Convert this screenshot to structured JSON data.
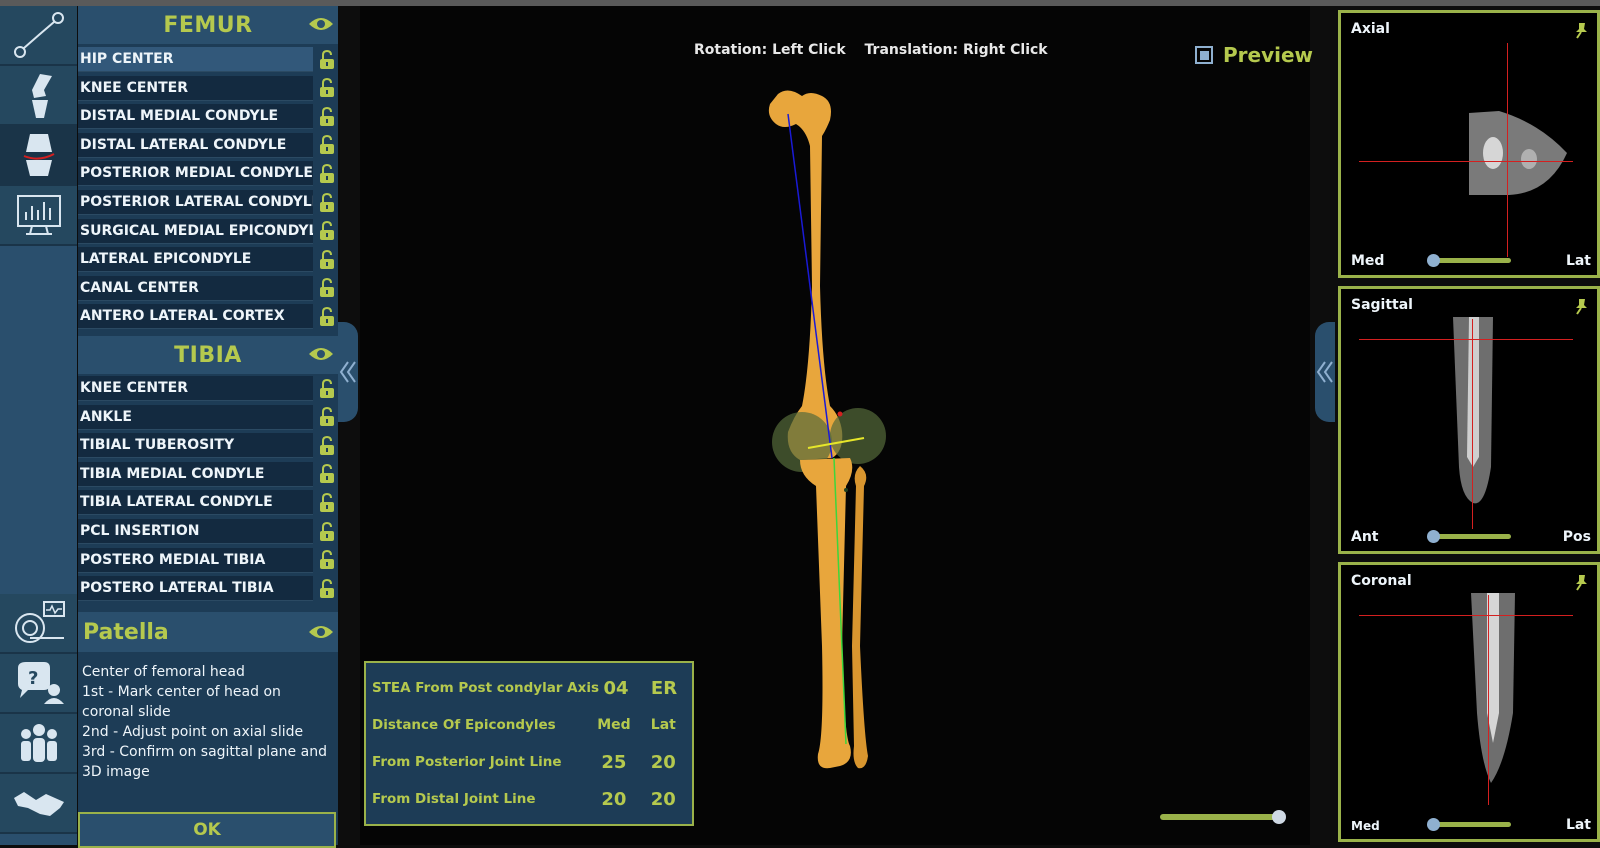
{
  "femur": {
    "title": "FEMUR",
    "items": [
      {
        "label": "HIP CENTER",
        "selected": true
      },
      {
        "label": "KNEE CENTER"
      },
      {
        "label": "DISTAL MEDIAL CONDYLE"
      },
      {
        "label": "DISTAL LATERAL CONDYLE"
      },
      {
        "label": "POSTERIOR MEDIAL CONDYLE"
      },
      {
        "label": "POSTERIOR LATERAL CONDYLE"
      },
      {
        "label": "SURGICAL MEDIAL EPICONDYLE"
      },
      {
        "label": "LATERAL EPICONDYLE"
      },
      {
        "label": "CANAL CENTER"
      },
      {
        "label": "ANTERO LATERAL CORTEX"
      }
    ]
  },
  "tibia": {
    "title": "TIBIA",
    "items": [
      {
        "label": "KNEE CENTER"
      },
      {
        "label": "ANKLE"
      },
      {
        "label": "TIBIAL TUBEROSITY"
      },
      {
        "label": "TIBIA MEDIAL CONDYLE"
      },
      {
        "label": "TIBIA LATERAL CONDYLE"
      },
      {
        "label": "PCL INSERTION"
      },
      {
        "label": "POSTERO MEDIAL TIBIA"
      },
      {
        "label": "POSTERO LATERAL TIBIA"
      }
    ]
  },
  "patella": {
    "title": "Patella",
    "instructions": [
      "Center of femoral head",
      "1st - Mark center of head on coronal slide",
      "2nd - Adjust point on axial slide",
      "3rd - Confirm on sagittal plane and 3D image"
    ],
    "ok_label": "OK"
  },
  "viewport": {
    "rotation_hint": "Rotation: Left Click",
    "translation_hint": "Translation: Right Click",
    "preview_label": "Preview",
    "preview_checked": true
  },
  "metrics": [
    {
      "label": "STEA From Post condylar Axis",
      "v1": "04",
      "v2": "ER"
    },
    {
      "label": "Distance Of Epicondyles",
      "v1": "Med",
      "v2": "Lat"
    },
    {
      "label": "From Posterior Joint Line",
      "v1": "25",
      "v2": "20"
    },
    {
      "label": "From Distal Joint Line",
      "v1": "20",
      "v2": "20"
    }
  ],
  "ct_views": [
    {
      "title": "Axial",
      "left_label": "Med",
      "right_label": "Lat"
    },
    {
      "title": "Sagittal",
      "left_label": "Ant",
      "right_label": "Pos"
    },
    {
      "title": "Coronal",
      "left_label": "Med",
      "right_label": "Lat"
    }
  ],
  "rail_icons": [
    "axis-line-icon",
    "knee-joint-icon",
    "knee-resection-icon",
    "monitor-chart-icon",
    "ct-scanner-icon",
    "help-chat-icon",
    "team-icon",
    "handshake-icon"
  ],
  "colors": {
    "accent": "#b5c94e",
    "panel": "#1d3c56",
    "selected": "#32587a",
    "bone": "#e8a63c"
  }
}
